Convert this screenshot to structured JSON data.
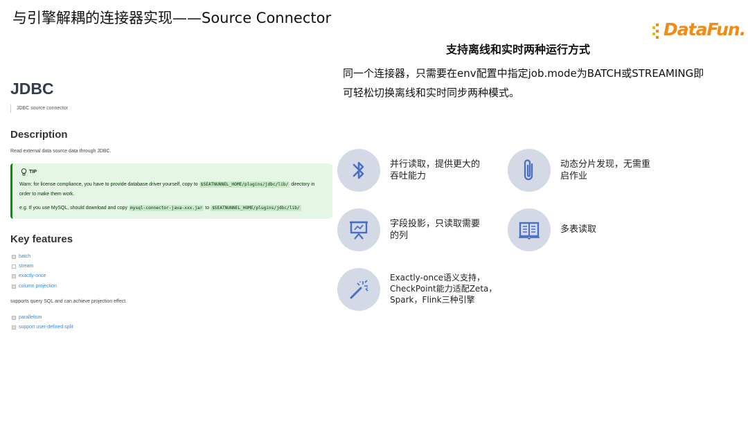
{
  "slide_title": "与引擎解耦的连接器实现——Source Connector",
  "logo_text": "DataFun.",
  "doc": {
    "title": "JDBC",
    "subtitle": "JDBC source connector",
    "description_heading": "Description",
    "description_text": "Read external data source data through JDBC.",
    "tip": {
      "label": "TIP",
      "line1_before": "Warn: for license compliance, you have to provide database driver yourself, copy to",
      "line1_code": "$SEATNUNNEL_HOME/plugins/jdbc/lib/",
      "line1_after": "directory in",
      "line2": "order to make them work.",
      "line3_before": "e.g. If you use MySQL, should download and copy",
      "line3_code1": "mysql-connector-java-xxx.jar",
      "line3_mid": "to",
      "line3_code2": "$SEATNUNNEL_HOME/plugins/jdbc/lib/"
    },
    "key_features_heading": "Key features",
    "features": [
      {
        "label": "batch",
        "checked": true
      },
      {
        "label": "stream",
        "checked": false
      },
      {
        "label": "exactly-once",
        "checked": true
      },
      {
        "label": "column projection",
        "checked": true
      }
    ],
    "projection_note": "supports query SQL and can achieve projection effect.",
    "features2": [
      {
        "label": "parallelism",
        "checked": true
      },
      {
        "label": "support user-defined split",
        "checked": true
      }
    ]
  },
  "right": {
    "heading": "支持离线和实时两种运行方式",
    "para_line1": "同一个连接器，只需要在env配置中指定job.mode为BATCH或STREAMING即",
    "para_line2": "可轻松切换离线和实时同步两种模式。",
    "features": [
      {
        "icon": "bluetooth-icon",
        "line1": "并行读取，提供更大的",
        "line2": "吞吐能力",
        "line3": ""
      },
      {
        "icon": "paperclip-icon",
        "line1": "动态分片发现，无需重",
        "line2": "启作业",
        "line3": ""
      },
      {
        "icon": "presentation-icon",
        "line1": "字段投影，只读取需要",
        "line2": "的列",
        "line3": ""
      },
      {
        "icon": "book-icon",
        "line1": "多表读取",
        "line2": "",
        "line3": ""
      },
      {
        "icon": "magic-wand-icon",
        "line1": "Exactly-once语义支持，",
        "line2": "CheckPoint能力适配Zeta，",
        "line3": "Spark，Flink三种引擎"
      }
    ]
  },
  "colors": {
    "logo_orange": "#f08b17",
    "icon_circle": "#d4d9e6",
    "icon_blue": "#4a6fc2",
    "tip_bg": "#e6f6e6",
    "tip_border": "#009400",
    "feature_link": "#2e8be6"
  }
}
